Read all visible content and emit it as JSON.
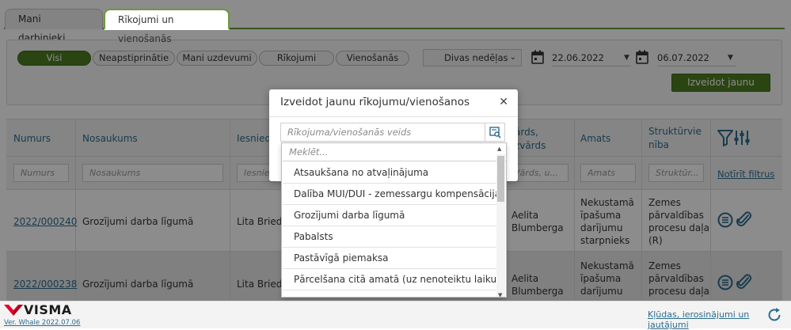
{
  "tabs": [
    {
      "label": "Mani darbinieki",
      "active": false
    },
    {
      "label": "Rīkojumi un vienošanās",
      "active": true
    }
  ],
  "filters": {
    "pills": [
      "Visi",
      "Neapstiprinātie",
      "Mani uzdevumi",
      "Rīkojumi",
      "Vienošanās"
    ],
    "active_pill": "Visi",
    "period": "Divas nedēļas",
    "date_from": "22.06.2022",
    "date_to": "06.07.2022",
    "create_button": "Izveidot jaunu"
  },
  "table": {
    "headers": {
      "number": "Numurs",
      "name": "Nosaukums",
      "submitter": "Iesniedz",
      "person_a": "ārds,",
      "person_b": "zvārds",
      "position": "Amats",
      "unit_a": "Struktūrvie",
      "unit_b": "nība"
    },
    "filter_placeholders": {
      "number": "Numurs",
      "name": "Nosaukums",
      "submitter": "Iesnie",
      "person": "Vārds, u...",
      "position": "Amats",
      "unit": "Struktūr..."
    },
    "clear_filters": "Notīrīt filtrus",
    "rows": [
      {
        "number": "2022/000240",
        "name": "Grozījumi darba līgumā",
        "submitter": "Lita Briede",
        "person_a": "Aelita",
        "person_b": "Blumberga",
        "position": [
          "Nekustamā",
          "īpašuma",
          "darījumu",
          "starpnieks"
        ],
        "unit": [
          "Zemes",
          "pārvaldības",
          "procesu daļa",
          "(R)"
        ]
      },
      {
        "number": "2022/000238",
        "name": "Grozījumi darba līgumā",
        "submitter": "Lita Briede",
        "person_a": "Aelita",
        "person_b": "Blumberga",
        "position": [
          "Nekustamā",
          "īpašuma",
          "darījumu"
        ],
        "unit": [
          "Zemes",
          "pārvaldības",
          "procesu daļa"
        ]
      }
    ]
  },
  "modal": {
    "title": "Izveidot jaunu rīkojumu/vienošanos",
    "type_placeholder": "Rīkojuma/vienošanās veids"
  },
  "dropdown": {
    "search_placeholder": "Meklēt...",
    "options": [
      "Atsaukšana no atvaļinājuma",
      "Dalība MUI/DUI - zemessargu kompensācija",
      "Grozījumi darba līgumā",
      "Pabalsts",
      "Pastāvīgā piemaksa",
      "Pārcelšana citā amatā (uz nenoteiktu laiku)"
    ]
  },
  "footer": {
    "brand": "VISMA",
    "version": "Ver. Whale 2022.07.06",
    "feedback": "Kļūdas, ierosinājumi un jautājumi"
  },
  "colors": {
    "accent_green": "#4f7f22",
    "link_blue": "#2d6d8f",
    "brand_red": "#e4002b"
  }
}
